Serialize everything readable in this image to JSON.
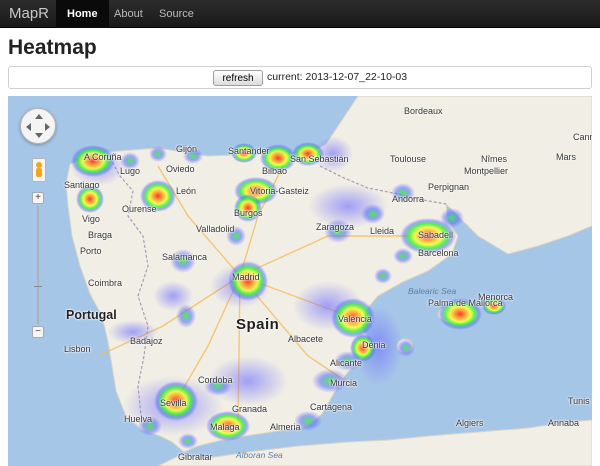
{
  "navbar": {
    "brand": "MapR",
    "items": [
      {
        "label": "Home",
        "active": true
      },
      {
        "label": "About",
        "active": false
      },
      {
        "label": "Source",
        "active": false
      }
    ]
  },
  "page": {
    "title": "Heatmap"
  },
  "toolbar": {
    "refresh_label": "refresh",
    "current_text": "current: 2013-12-07_22-10-03"
  },
  "map": {
    "labels": [
      "A Coruña",
      "Lugo",
      "Gijón",
      "Oviedo",
      "Santander",
      "San Sebastián",
      "Bilbao",
      "Vitoria-Gasteiz",
      "Santiago",
      "Ourense",
      "Vigo",
      "León",
      "Burgos",
      "Bordeaux",
      "Toulouse",
      "Nîmes",
      "Montpellier",
      "Perpignan",
      "Andorra",
      "Zaragoza",
      "Lleida",
      "Sabadell",
      "Barcelona",
      "Braga",
      "Porto",
      "Valladolid",
      "Salamanca",
      "Madrid",
      "Coimbra",
      "Portugal",
      "Spain",
      "Lisbon",
      "Badajoz",
      "Valencia",
      "Albacete",
      "Palma de Mallorca",
      "Balearic Sea",
      "Menorca",
      "Alicante",
      "Murcia",
      "Cordoba",
      "Sevilla",
      "Granada",
      "Huelva",
      "Malaga",
      "Almeria",
      "Cartagena",
      "Gibraltar",
      "Alboran Sea",
      "Algiers",
      "Annaba",
      "Tunis",
      "Dénia",
      "Cannes",
      "Mars"
    ],
    "colors": {
      "sea": "#a6c6e8",
      "land": "#f1eee5",
      "heat_cold": "#7f7fff",
      "heat_mid": "#2cf22c",
      "heat_warm": "#ffff30",
      "heat_hot": "#ff3a25"
    },
    "controls": [
      "pan-control",
      "pegman",
      "zoom-in",
      "zoom-out",
      "zoom-slider"
    ]
  }
}
